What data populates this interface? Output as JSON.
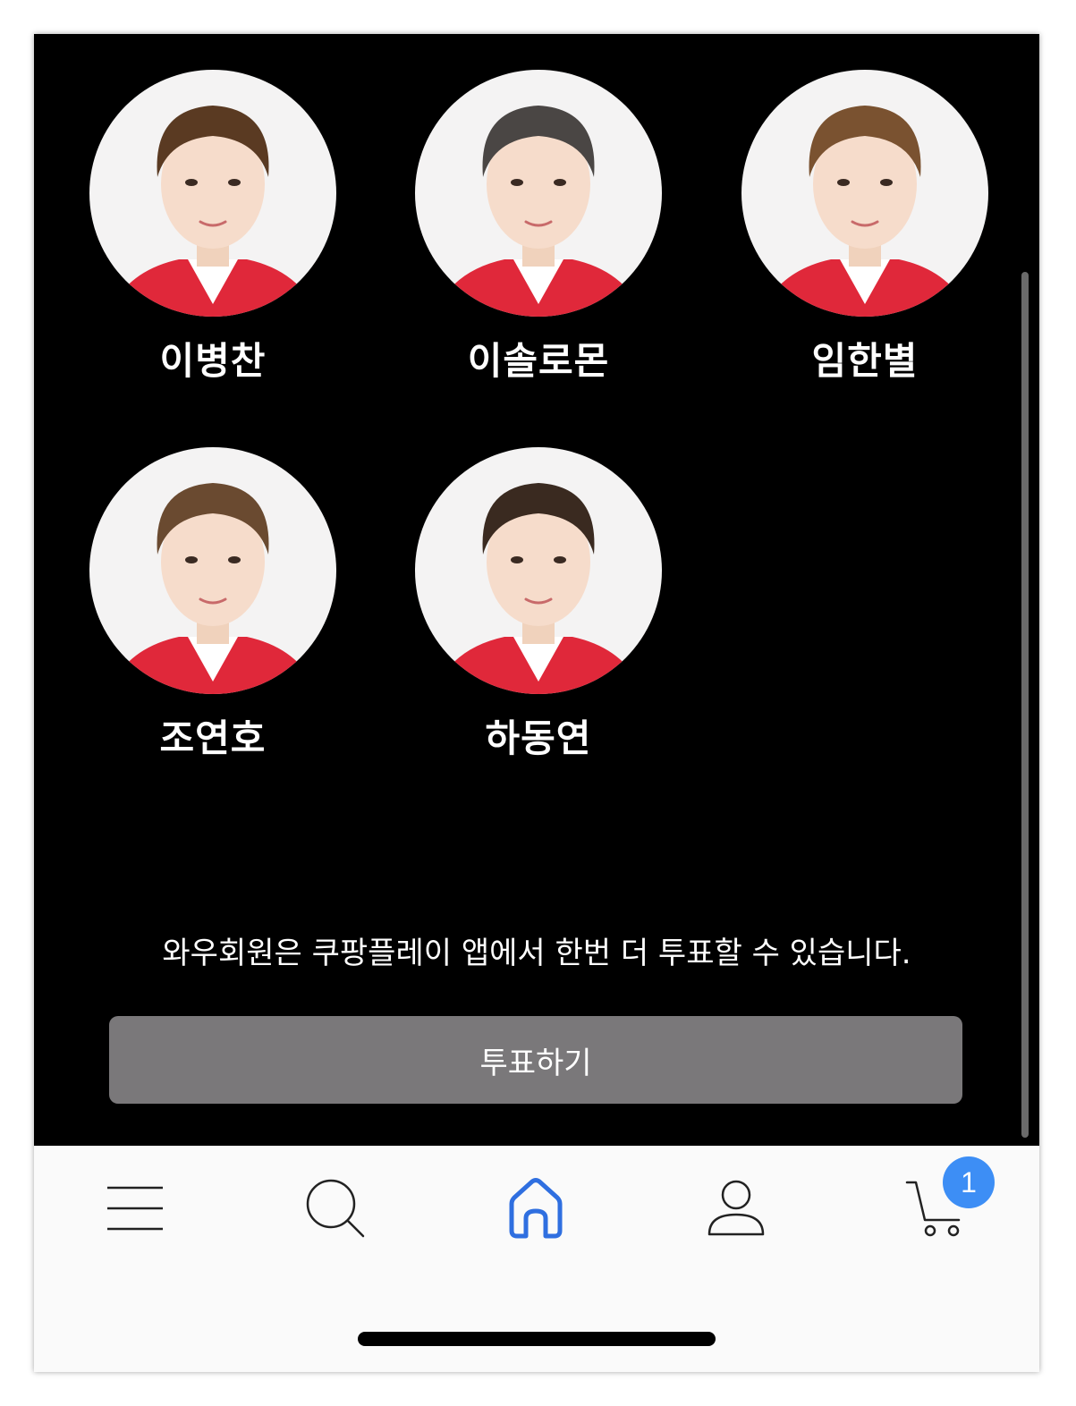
{
  "candidates": [
    {
      "name": "이병찬",
      "hair": "#5a3a22"
    },
    {
      "name": "이솔로몬",
      "hair": "#4a4644"
    },
    {
      "name": "임한별",
      "hair": "#7a5230"
    },
    {
      "name": "조연호",
      "hair": "#6a4a30"
    },
    {
      "name": "하동연",
      "hair": "#3a2a20"
    }
  ],
  "notice": "와우회원은 쿠팡플레이 앱에서 한번 더 투표할 수 있습니다.",
  "vote_button": "투표하기",
  "tabbar": {
    "items": [
      {
        "icon": "menu-icon"
      },
      {
        "icon": "search-icon"
      },
      {
        "icon": "home-icon",
        "active": true
      },
      {
        "icon": "user-icon"
      },
      {
        "icon": "cart-icon",
        "badge": "1"
      }
    ]
  },
  "colors": {
    "background": "#000000",
    "button": "#7a787a",
    "active_tab": "#2f6fe0",
    "badge": "#3d8ef5",
    "jacket": "#e0283a"
  }
}
